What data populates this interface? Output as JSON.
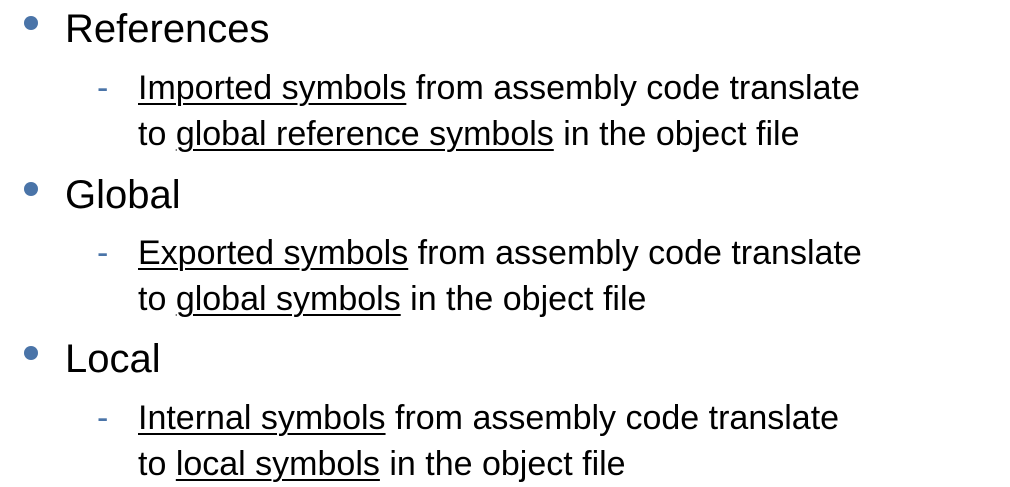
{
  "colors": {
    "bullet": "#4a74a8",
    "dash": "#4a74a8",
    "text": "#000000"
  },
  "sections": [
    {
      "heading": "References",
      "detail": {
        "lead_term": "Imported symbols",
        "middle": " from assembly code translate",
        "line2_prefix": "to ",
        "target_term": "global reference symbols",
        "line2_suffix": " in the object file"
      }
    },
    {
      "heading": "Global",
      "detail": {
        "lead_term": "Exported symbols",
        "middle": " from assembly code translate",
        "line2_prefix": "to ",
        "target_term": "global symbols",
        "line2_suffix": " in the object file"
      }
    },
    {
      "heading": "Local",
      "detail": {
        "lead_term": "Internal symbols",
        "middle": " from assembly code translate",
        "line2_prefix": "to ",
        "target_term": "local symbols",
        "line2_suffix": " in the object file"
      }
    }
  ],
  "dash_glyph": "-"
}
